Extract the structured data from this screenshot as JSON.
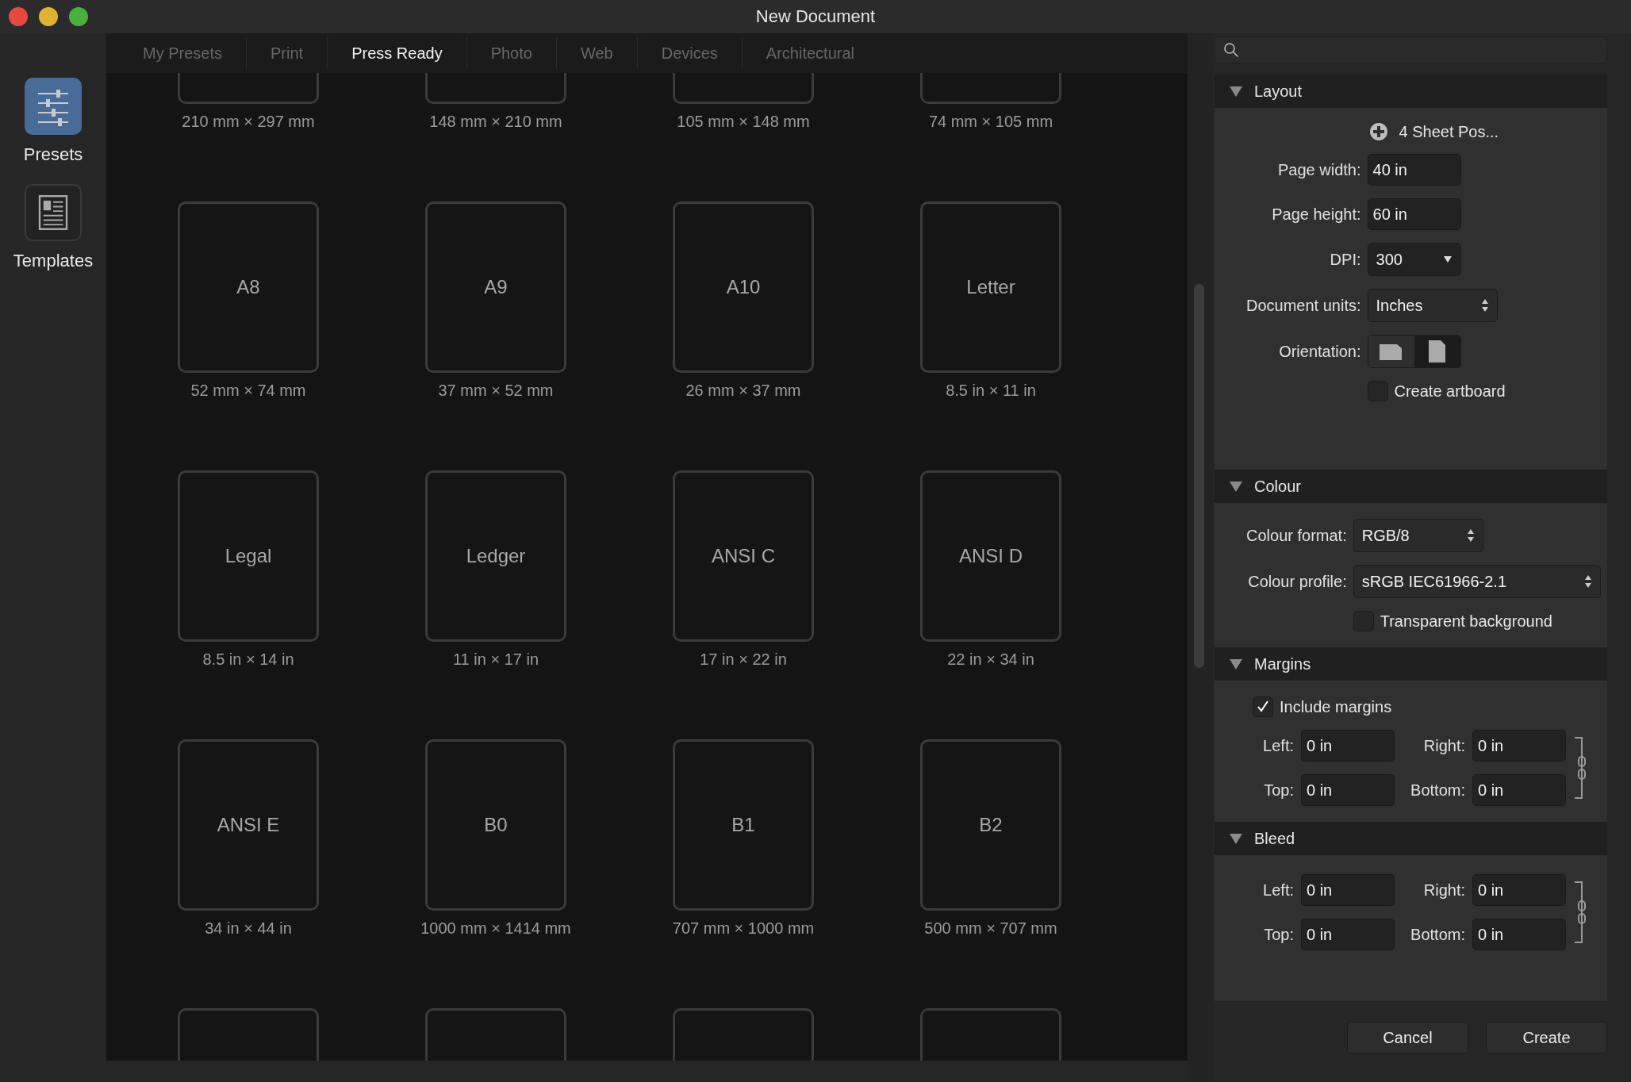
{
  "window": {
    "title": "New Document"
  },
  "sidebar": {
    "items": [
      {
        "label": "Presets",
        "kind": "presets",
        "selected": true
      },
      {
        "label": "Templates",
        "kind": "templates",
        "selected": false
      }
    ]
  },
  "tabs": [
    {
      "label": "My Presets",
      "selected": false
    },
    {
      "label": "Print",
      "selected": false
    },
    {
      "label": "Press Ready",
      "selected": true
    },
    {
      "label": "Photo",
      "selected": false
    },
    {
      "label": "Web",
      "selected": false
    },
    {
      "label": "Devices",
      "selected": false
    },
    {
      "label": "Architectural",
      "selected": false
    }
  ],
  "presets": {
    "rows": [
      [
        {
          "kind": "preset",
          "size": "210 mm × 297 mm"
        },
        {
          "kind": "preset",
          "size": "148 mm × 210 mm"
        },
        {
          "kind": "preset",
          "size": "105 mm × 148 mm"
        },
        {
          "kind": "preset",
          "size": "74 mm × 105 mm"
        }
      ],
      [
        {
          "kind": "preset",
          "name": "A8",
          "size": "52 mm × 74 mm"
        },
        {
          "kind": "preset",
          "name": "A9",
          "size": "37 mm × 52 mm"
        },
        {
          "kind": "preset",
          "name": "A10",
          "size": "26 mm × 37 mm"
        },
        {
          "kind": "preset",
          "name": "Letter",
          "size": "8.5 in × 11 in"
        }
      ],
      [
        {
          "kind": "preset",
          "name": "Legal",
          "size": "8.5 in × 14 in"
        },
        {
          "kind": "preset",
          "name": "Ledger",
          "size": "11 in × 17 in"
        },
        {
          "kind": "preset",
          "name": "ANSI C",
          "size": "17 in × 22 in"
        },
        {
          "kind": "preset",
          "name": "ANSI D",
          "size": "22 in × 34 in"
        }
      ],
      [
        {
          "kind": "preset",
          "name": "ANSI E",
          "size": "34 in × 44 in"
        },
        {
          "kind": "preset",
          "name": "B0",
          "size": "1000 mm × 1414 mm"
        },
        {
          "kind": "preset",
          "name": "B1",
          "size": "707 mm × 1000 mm"
        },
        {
          "kind": "preset",
          "name": "B2",
          "size": "500 mm × 707 mm"
        }
      ],
      [
        {
          "kind": "blank"
        },
        {
          "kind": "blank"
        },
        {
          "kind": "blank"
        },
        {
          "kind": "blank"
        }
      ]
    ]
  },
  "sections": [
    {
      "title": "Layout",
      "expanded": true,
      "rows": [
        {
          "kind": "preset",
          "value": "4 Sheet Pos..."
        },
        {
          "kind": "field",
          "label": "Page width:",
          "value": "40 in"
        },
        {
          "kind": "field",
          "label": "Page height:",
          "value": "60 in"
        },
        {
          "kind": "dropdown",
          "label": "DPI:",
          "value": "300"
        },
        {
          "kind": "stepper",
          "label": "Document units:",
          "value": "Inches"
        },
        {
          "kind": "orientation",
          "label": "Orientation:",
          "options": [
            {
              "kind": "landscape",
              "selected": false
            },
            {
              "kind": "portrait",
              "selected": true
            }
          ]
        },
        {
          "kind": "checkbox",
          "label": "Create artboard",
          "checked": false
        }
      ]
    },
    {
      "title": "Colour",
      "expanded": true,
      "rows": [
        {
          "kind": "stepper",
          "label": "Colour format:",
          "value": "RGB/8"
        },
        {
          "kind": "wide-stepper",
          "label": "Colour profile:",
          "value": "sRGB IEC61966-2.1"
        },
        {
          "kind": "checkbox",
          "label": "Transparent background",
          "checked": false
        }
      ]
    },
    {
      "title": "Margins",
      "expanded": true,
      "rows": [
        {
          "kind": "checkbox",
          "label": "Include margins",
          "checked": true
        },
        {
          "kind": "quad",
          "fields": [
            {
              "label": "Left:",
              "value": "0 in"
            },
            {
              "label": "Right:",
              "value": "0 in"
            },
            {
              "label": "Top:",
              "value": "0 in"
            },
            {
              "label": "Bottom:",
              "value": "0 in"
            }
          ]
        }
      ]
    },
    {
      "title": "Bleed",
      "expanded": true,
      "rows": [
        {
          "kind": "quad",
          "fields": [
            {
              "label": "Left:",
              "value": "0 in"
            },
            {
              "label": "Right:",
              "value": "0 in"
            },
            {
              "label": "Top:",
              "value": "0 in"
            },
            {
              "label": "Bottom:",
              "value": "0 in"
            }
          ]
        }
      ]
    }
  ],
  "buttons": [
    {
      "label": "Cancel"
    },
    {
      "label": "Create"
    }
  ]
}
